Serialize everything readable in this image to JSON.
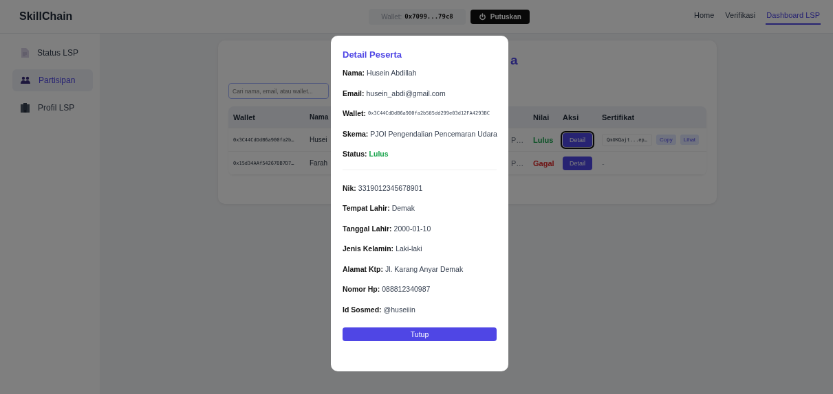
{
  "header": {
    "brand": "SkillChain",
    "wallet_label": "Wallet:",
    "wallet_address": "0x7099...79c8",
    "disconnect": "Putuskan",
    "nav": [
      {
        "label": "Home",
        "selected": false
      },
      {
        "label": "Verifikasi",
        "selected": false
      },
      {
        "label": "Dashboard LSP",
        "selected": true
      }
    ]
  },
  "sidebar": {
    "items": [
      {
        "label": "Status LSP",
        "kind": "document",
        "selected": false
      },
      {
        "label": "Partisipan",
        "kind": "people",
        "selected": true
      },
      {
        "label": "Profil LSP",
        "kind": "building",
        "selected": false
      }
    ]
  },
  "content": {
    "title_fragment": "a",
    "search": {
      "placeholder": "Cari nama, email, atau wallet..."
    },
    "table": {
      "columns": [
        "Wallet",
        "Nama",
        "Nilai",
        "Aksi",
        "Sertifikat"
      ],
      "rows": [
        {
          "wallet": "0x3C44CdDdB6a900fa2b…",
          "name": "Husei",
          "skema": "P…",
          "nilai": "Lulus",
          "passed": true,
          "action": "Detail",
          "focused": true,
          "certificate": {
            "kind": "issued",
            "cid": "QmUKQajt...ep…",
            "copy": "Copy",
            "view": "Lihat"
          }
        },
        {
          "wallet": "0x15d34AAf54267DB7D7…",
          "name": "Farah",
          "skema": "P…",
          "nilai": "Gagal",
          "passed": false,
          "action": "Detail",
          "focused": false,
          "certificate": {
            "kind": "none",
            "text": "-"
          }
        }
      ]
    }
  },
  "modal": {
    "title": "Detail Peserta",
    "fields": [
      {
        "label": "Nama:",
        "value": "Husein Abdillah",
        "kind": "text"
      },
      {
        "label": "Email:",
        "value": "husein_abdi@gmail.com",
        "kind": "text"
      },
      {
        "label": "Wallet:",
        "value": "0x3C44CdDdB6a900fa2b585dd299e03d12FA4293BC",
        "kind": "code"
      },
      {
        "label": "Skema:",
        "value": "PJOI Pengendalian Pencemaran Udara",
        "kind": "text"
      },
      {
        "label": "Status:",
        "value": "Lulus",
        "kind": "status"
      }
    ],
    "details": [
      {
        "label": "Nik:",
        "value": "3319012345678901"
      },
      {
        "label": "Tempat Lahir:",
        "value": "Demak"
      },
      {
        "label": "Tanggal Lahir:",
        "value": "2000-01-10"
      },
      {
        "label": "Jenis Kelamin:",
        "value": "Laki-laki"
      },
      {
        "label": "Alamat Ktp:",
        "value": "Jl. Karang Anyar Demak"
      },
      {
        "label": "Nomor Hp:",
        "value": "088812340987"
      },
      {
        "label": "Id Sosmed:",
        "value": "@huseiiin"
      }
    ],
    "close": "Tutup"
  }
}
